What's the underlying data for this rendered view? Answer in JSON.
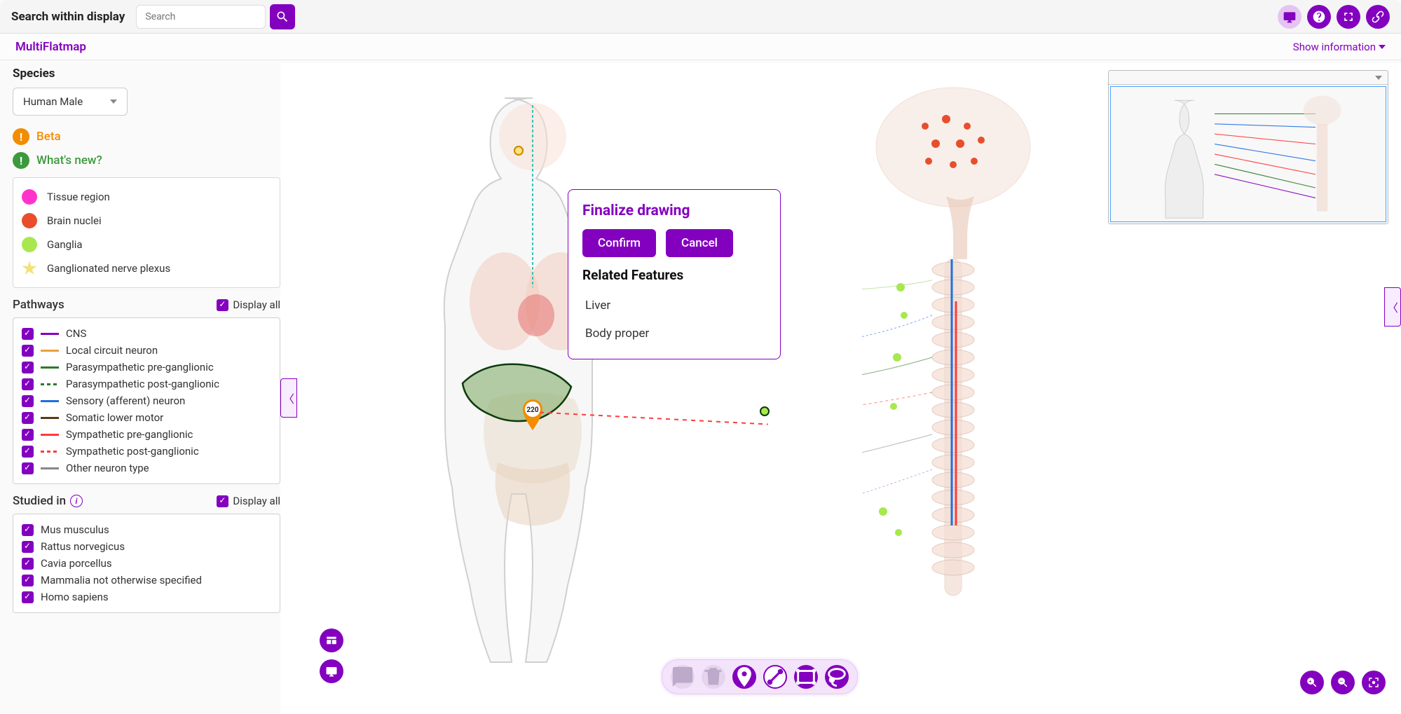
{
  "topbar": {
    "search_label": "Search within display",
    "search_placeholder": "Search"
  },
  "subheader": {
    "title": "MultiFlatmap",
    "show_info": "Show information"
  },
  "left": {
    "species_label": "Species",
    "species_value": "Human Male",
    "beta": "Beta",
    "whats_new": "What's new?",
    "legend": [
      {
        "label": "Tissue region"
      },
      {
        "label": "Brain nuclei"
      },
      {
        "label": "Ganglia"
      },
      {
        "label": "Ganglionated nerve plexus"
      }
    ],
    "pathways_title": "Pathways",
    "display_all": "Display all",
    "pathways": [
      {
        "label": "CNS",
        "color": "#8300bf",
        "style": "solid"
      },
      {
        "label": "Local circuit neuron",
        "color": "#e8a23a",
        "style": "solid"
      },
      {
        "label": "Parasympathetic pre-ganglionic",
        "color": "#2c7a2c",
        "style": "solid"
      },
      {
        "label": "Parasympathetic post-ganglionic",
        "color": "#2c7a2c",
        "style": "dashed"
      },
      {
        "label": "Sensory (afferent) neuron",
        "color": "#1f6fe0",
        "style": "solid"
      },
      {
        "label": "Somatic lower motor",
        "color": "#5a3a1a",
        "style": "solid"
      },
      {
        "label": "Sympathetic pre-ganglionic",
        "color": "#ff3b3b",
        "style": "solid"
      },
      {
        "label": "Sympathetic post-ganglionic",
        "color": "#ff3b3b",
        "style": "dashed"
      },
      {
        "label": "Other neuron type",
        "color": "#888888",
        "style": "solid"
      }
    ],
    "studiedin_title": "Studied in",
    "studiedin": [
      {
        "label": "Mus musculus"
      },
      {
        "label": "Rattus norvegicus"
      },
      {
        "label": "Cavia porcellus"
      },
      {
        "label": "Mammalia not otherwise specified"
      },
      {
        "label": "Homo sapiens"
      }
    ]
  },
  "popup": {
    "title": "Finalize drawing",
    "confirm": "Confirm",
    "cancel": "Cancel",
    "related_title": "Related Features",
    "features": [
      "Liver",
      "Body proper"
    ]
  },
  "marker": {
    "value": "220"
  }
}
